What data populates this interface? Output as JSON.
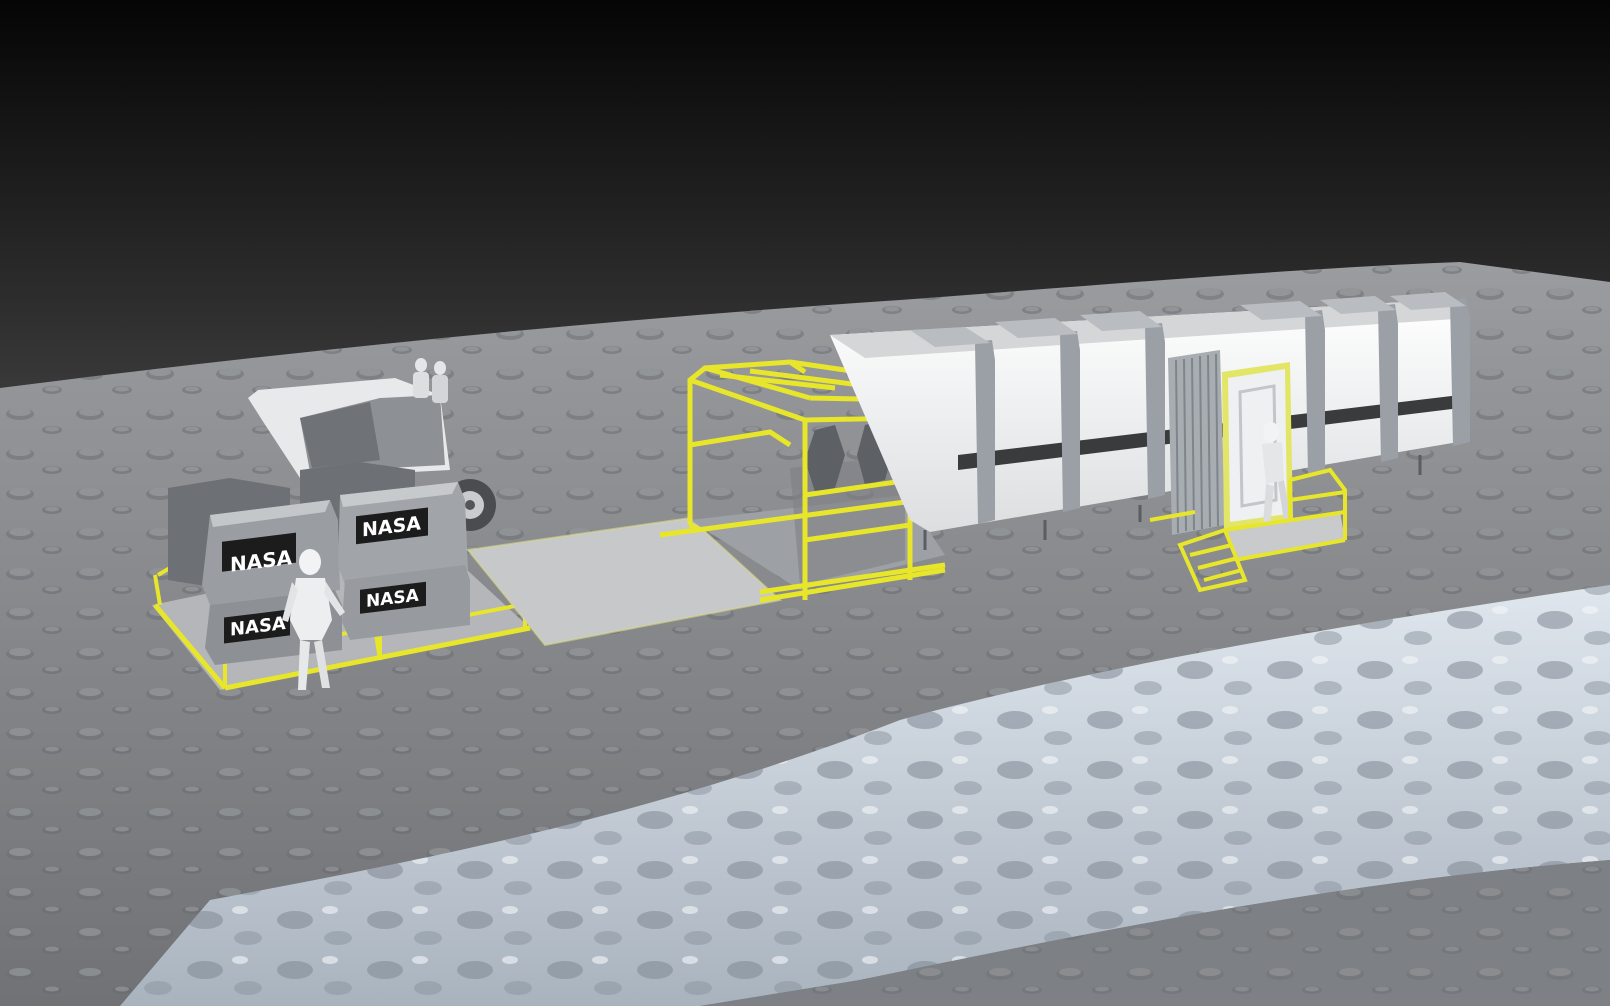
{
  "scene": {
    "description_label": "",
    "logo_text": "NASA",
    "colors": {
      "sky_top": "#050505",
      "sky_bottom": "#3d3d3d",
      "regolith": "#8f9194",
      "regolith_dark": "#5d6064",
      "trench_light": "#c9d2dd",
      "habitat_white": "#f1f2f3",
      "habitat_rib": "#9aa0a6",
      "accent_yellow": "#e7e62a",
      "module_grey": "#8b8e92"
    }
  }
}
